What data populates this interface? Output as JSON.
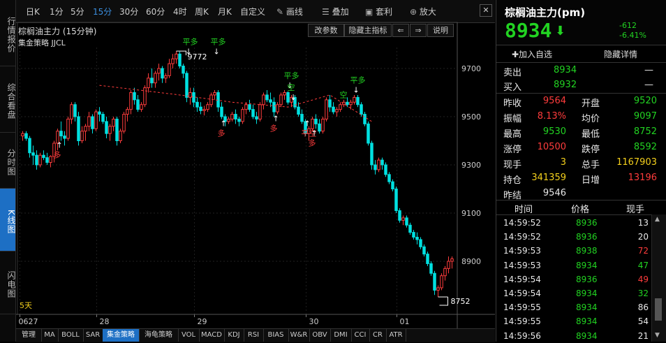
{
  "left_tabs": [
    {
      "label": "行情报价",
      "active": false
    },
    {
      "label": "综合看盘",
      "active": false
    },
    {
      "label": "分时图",
      "active": false
    },
    {
      "label": "K线图",
      "active": true
    },
    {
      "label": "闪电图",
      "active": false
    }
  ],
  "toolbar": {
    "periods": [
      "日K",
      "1分",
      "5分",
      "15分",
      "30分",
      "60分",
      "4时",
      "周K",
      "月K",
      "自定义"
    ],
    "active_period": "15分",
    "draw_label": "画线",
    "overlay_label": "叠加",
    "arbitrage_label": "套利",
    "zoom_label": "放大"
  },
  "chart_header": {
    "title": "棕榈油主力 (15分钟)",
    "strategy": "集金策略 JJCL",
    "btn_params": "改参数",
    "btn_hide_main": "隐藏主指标",
    "btn_help": "说明",
    "arrow_left": "⇐",
    "arrow_right": "⇒"
  },
  "chart_data": {
    "type": "candlestick",
    "y_ticks": [
      "9700",
      "9500",
      "9300",
      "9100",
      "8900"
    ],
    "x_ticks": [
      "0627",
      "28",
      "29",
      "30",
      "01"
    ],
    "marker_high": "9772",
    "marker_low": "8752",
    "corner_label": "5天",
    "signals": [
      "多",
      "平多",
      "平多",
      "多",
      "多",
      "平多",
      "空",
      "平空",
      "多",
      "平多",
      "空"
    ],
    "candles": [
      [
        9420,
        9440,
        9400,
        9430
      ],
      [
        9430,
        9440,
        9400,
        9410
      ],
      [
        9410,
        9420,
        9330,
        9350
      ],
      [
        9350,
        9380,
        9300,
        9340
      ],
      [
        9340,
        9360,
        9280,
        9300
      ],
      [
        9300,
        9350,
        9290,
        9340
      ],
      [
        9340,
        9360,
        9320,
        9330
      ],
      [
        9330,
        9350,
        9300,
        9310
      ],
      [
        9310,
        9340,
        9290,
        9335
      ],
      [
        9335,
        9400,
        9310,
        9390
      ],
      [
        9390,
        9450,
        9360,
        9440
      ],
      [
        9440,
        9480,
        9400,
        9420
      ],
      [
        9420,
        9440,
        9380,
        9410
      ],
      [
        9410,
        9500,
        9400,
        9490
      ],
      [
        9490,
        9560,
        9470,
        9550
      ],
      [
        9550,
        9560,
        9480,
        9500
      ],
      [
        9500,
        9520,
        9380,
        9400
      ],
      [
        9400,
        9460,
        9390,
        9440
      ],
      [
        9440,
        9470,
        9400,
        9460
      ],
      [
        9460,
        9520,
        9440,
        9500
      ],
      [
        9500,
        9510,
        9430,
        9450
      ],
      [
        9450,
        9530,
        9440,
        9520
      ],
      [
        9520,
        9540,
        9480,
        9510
      ],
      [
        9510,
        9520,
        9470,
        9480
      ],
      [
        9480,
        9500,
        9410,
        9430
      ],
      [
        9430,
        9470,
        9400,
        9460
      ],
      [
        9460,
        9500,
        9440,
        9490
      ],
      [
        9490,
        9500,
        9380,
        9400
      ],
      [
        9400,
        9450,
        9390,
        9440
      ],
      [
        9440,
        9520,
        9430,
        9510
      ],
      [
        9510,
        9540,
        9480,
        9530
      ],
      [
        9530,
        9610,
        9510,
        9600
      ],
      [
        9600,
        9620,
        9550,
        9570
      ],
      [
        9570,
        9590,
        9520,
        9530
      ],
      [
        9530,
        9560,
        9520,
        9550
      ],
      [
        9550,
        9630,
        9540,
        9620
      ],
      [
        9620,
        9680,
        9600,
        9660
      ],
      [
        9660,
        9700,
        9620,
        9640
      ],
      [
        9640,
        9690,
        9620,
        9680
      ],
      [
        9680,
        9720,
        9650,
        9700
      ],
      [
        9700,
        9710,
        9640,
        9660
      ],
      [
        9660,
        9680,
        9640,
        9670
      ],
      [
        9670,
        9740,
        9660,
        9720
      ],
      [
        9720,
        9760,
        9700,
        9740
      ],
      [
        9740,
        9772,
        9720,
        9760
      ],
      [
        9760,
        9770,
        9700,
        9710
      ],
      [
        9710,
        9720,
        9660,
        9680
      ],
      [
        9680,
        9690,
        9560,
        9580
      ],
      [
        9580,
        9620,
        9550,
        9600
      ],
      [
        9600,
        9620,
        9540,
        9560
      ],
      [
        9560,
        9580,
        9520,
        9540
      ],
      [
        9540,
        9560,
        9510,
        9525
      ],
      [
        9525,
        9545,
        9505,
        9530
      ],
      [
        9530,
        9560,
        9520,
        9550
      ],
      [
        9550,
        9600,
        9540,
        9590
      ],
      [
        9590,
        9610,
        9570,
        9600
      ],
      [
        9600,
        9610,
        9520,
        9540
      ],
      [
        9540,
        9560,
        9490,
        9500
      ],
      [
        9500,
        9510,
        9460,
        9480
      ],
      [
        9480,
        9500,
        9470,
        9490
      ],
      [
        9490,
        9520,
        9480,
        9510
      ],
      [
        9510,
        9530,
        9470,
        9490
      ],
      [
        9490,
        9500,
        9460,
        9480
      ],
      [
        9480,
        9540,
        9470,
        9530
      ],
      [
        9530,
        9560,
        9510,
        9550
      ],
      [
        9550,
        9570,
        9520,
        9530
      ],
      [
        9530,
        9550,
        9490,
        9500
      ],
      [
        9500,
        9520,
        9470,
        9490
      ],
      [
        9490,
        9560,
        9480,
        9550
      ],
      [
        9550,
        9600,
        9530,
        9590
      ],
      [
        9590,
        9610,
        9560,
        9570
      ],
      [
        9570,
        9600,
        9540,
        9560
      ],
      [
        9560,
        9580,
        9500,
        9520
      ],
      [
        9520,
        9560,
        9510,
        9550
      ],
      [
        9550,
        9600,
        9540,
        9590
      ],
      [
        9590,
        9610,
        9570,
        9600
      ],
      [
        9600,
        9605,
        9550,
        9560
      ],
      [
        9560,
        9590,
        9540,
        9580
      ],
      [
        9580,
        9590,
        9530,
        9540
      ],
      [
        9540,
        9560,
        9500,
        9510
      ],
      [
        9510,
        9530,
        9470,
        9480
      ],
      [
        9480,
        9490,
        9420,
        9430
      ],
      [
        9430,
        9460,
        9400,
        9450
      ],
      [
        9450,
        9500,
        9440,
        9490
      ],
      [
        9490,
        9510,
        9450,
        9470
      ],
      [
        9470,
        9490,
        9430,
        9440
      ],
      [
        9440,
        9500,
        9430,
        9490
      ],
      [
        9490,
        9580,
        9480,
        9570
      ],
      [
        9570,
        9590,
        9520,
        9540
      ],
      [
        9540,
        9560,
        9510,
        9520
      ],
      [
        9520,
        9540,
        9500,
        9530
      ],
      [
        9530,
        9560,
        9520,
        9550
      ],
      [
        9550,
        9570,
        9540,
        9560
      ],
      [
        9560,
        9580,
        9540,
        9550
      ],
      [
        9550,
        9570,
        9530,
        9560
      ],
      [
        9560,
        9590,
        9550,
        9580
      ],
      [
        9580,
        9590,
        9540,
        9550
      ],
      [
        9550,
        9560,
        9500,
        9510
      ],
      [
        9510,
        9520,
        9460,
        9470
      ],
      [
        9470,
        9480,
        9380,
        9390
      ],
      [
        9390,
        9400,
        9280,
        9300
      ],
      [
        9300,
        9320,
        9260,
        9280
      ],
      [
        9280,
        9330,
        9270,
        9320
      ],
      [
        9320,
        9330,
        9280,
        9300
      ],
      [
        9300,
        9310,
        9250,
        9260
      ],
      [
        9260,
        9270,
        9220,
        9230
      ],
      [
        9230,
        9240,
        9190,
        9200
      ],
      [
        9200,
        9210,
        9100,
        9110
      ],
      [
        9110,
        9120,
        9060,
        9070
      ],
      [
        9070,
        9090,
        9050,
        9080
      ],
      [
        9080,
        9090,
        9040,
        9050
      ],
      [
        9050,
        9060,
        9010,
        9020
      ],
      [
        9020,
        9030,
        8990,
        9000
      ],
      [
        9000,
        9020,
        8970,
        8990
      ],
      [
        8990,
        9000,
        8950,
        8960
      ],
      [
        8960,
        8970,
        8920,
        8930
      ],
      [
        8930,
        8940,
        8880,
        8890
      ],
      [
        8890,
        8900,
        8840,
        8850
      ],
      [
        8850,
        8860,
        8760,
        8780
      ],
      [
        8780,
        8800,
        8752,
        8790
      ],
      [
        8790,
        8850,
        8780,
        8840
      ],
      [
        8840,
        8880,
        8820,
        8870
      ],
      [
        8870,
        8920,
        8850,
        8900
      ],
      [
        8900,
        8920,
        8870,
        8910
      ]
    ]
  },
  "quote": {
    "name": "棕榈油主力(pm)",
    "price": "8934",
    "arrow": "⬇",
    "change": "-612",
    "change_pct": "-6.41%",
    "add_watch": "✚加入自选",
    "hide_detail": "隐藏详情",
    "ask_label": "卖出",
    "ask": "8934",
    "ask_vol": "—",
    "bid_label": "买入",
    "bid": "8932",
    "bid_vol": "—",
    "stats": [
      {
        "l1": "昨收",
        "v1": "9564",
        "c1": "red",
        "l2": "开盘",
        "v2": "9520",
        "c2": "green"
      },
      {
        "l1": "振幅",
        "v1": "8.13%",
        "c1": "red",
        "l2": "均价",
        "v2": "9097",
        "c2": "green"
      },
      {
        "l1": "最高",
        "v1": "9530",
        "c1": "green",
        "l2": "最低",
        "v2": "8752",
        "c2": "green"
      },
      {
        "l1": "涨停",
        "v1": "10500",
        "c1": "red",
        "l2": "跌停",
        "v2": "8592",
        "c2": "green"
      },
      {
        "l1": "现手",
        "v1": "3",
        "c1": "yellow",
        "l2": "总手",
        "v2": "1167903",
        "c2": "yellow"
      },
      {
        "l1": "持仓",
        "v1": "341359",
        "c1": "yellow",
        "l2": "日增",
        "v2": "13196",
        "c2": "red"
      },
      {
        "l1": "昨结",
        "v1": "9546",
        "c1": "white",
        "l2": "",
        "v2": "",
        "c2": "white"
      }
    ],
    "tick_headers": [
      "时间",
      "价格",
      "现手"
    ],
    "ticks": [
      {
        "t": "14:59:52",
        "p": "8936",
        "v": "13",
        "vc": "white"
      },
      {
        "t": "14:59:52",
        "p": "8936",
        "v": "20",
        "vc": "white"
      },
      {
        "t": "14:59:53",
        "p": "8938",
        "v": "72",
        "vc": "red"
      },
      {
        "t": "14:59:53",
        "p": "8934",
        "v": "47",
        "vc": "green"
      },
      {
        "t": "14:59:54",
        "p": "8936",
        "v": "49",
        "vc": "red"
      },
      {
        "t": "14:59:54",
        "p": "8934",
        "v": "32",
        "vc": "green"
      },
      {
        "t": "14:59:55",
        "p": "8934",
        "v": "86",
        "vc": "white"
      },
      {
        "t": "14:59:55",
        "p": "8934",
        "v": "54",
        "vc": "white"
      },
      {
        "t": "14:59:56",
        "p": "8934",
        "v": "21",
        "vc": "white"
      }
    ]
  },
  "bottom_tabs": [
    "管理",
    "MA",
    "BOLL",
    "SAR",
    "集金策略",
    "海龟策略",
    "VOL",
    "MACD",
    "KDJ",
    "RSI",
    "BIAS",
    "W&R",
    "OBV",
    "DMI",
    "CCI",
    "CR",
    "ATR"
  ],
  "active_bottom_tab": "集金策略"
}
